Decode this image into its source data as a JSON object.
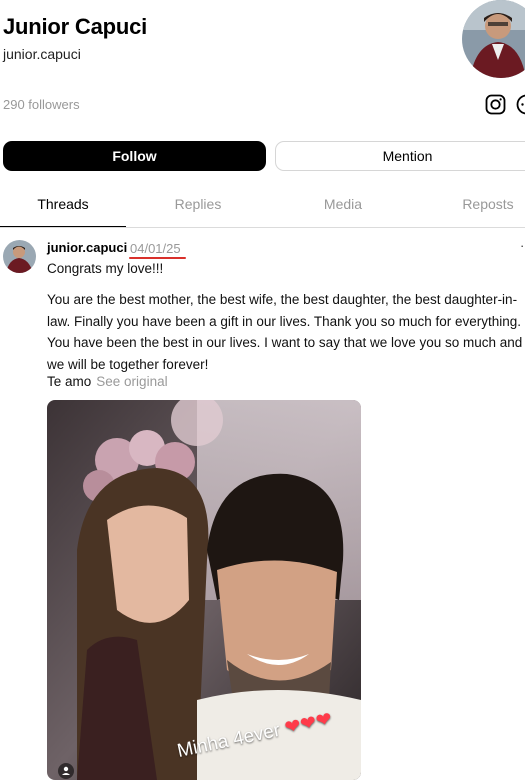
{
  "profile": {
    "display_name": "Junior Capuci",
    "username": "junior.capuci",
    "followers": "290 followers"
  },
  "actions": {
    "follow_label": "Follow",
    "mention_label": "Mention"
  },
  "tabs": [
    {
      "label": "Threads",
      "active": true
    },
    {
      "label": "Replies",
      "active": false
    },
    {
      "label": "Media",
      "active": false
    },
    {
      "label": "Reposts",
      "active": false
    }
  ],
  "post": {
    "author": "junior.capuci",
    "date": "04/01/25",
    "first_line": "Congrats my love!!!",
    "body": "You are the best mother, the best wife, the best daughter, the best daughter-in-law. Finally you have been a gift in our lives. Thank you so much for everything. You have been the best in our lives. I want to say that we love you so much and we will be together forever!",
    "translation_note": "Te amo",
    "see_original": "See original",
    "media_caption": "Minha 4ever"
  },
  "colors": {
    "accent_underline": "#d9302b",
    "muted_text": "#999999"
  },
  "icons": [
    "instagram-icon",
    "more-icon",
    "person-tag-icon",
    "heart-icon"
  ]
}
